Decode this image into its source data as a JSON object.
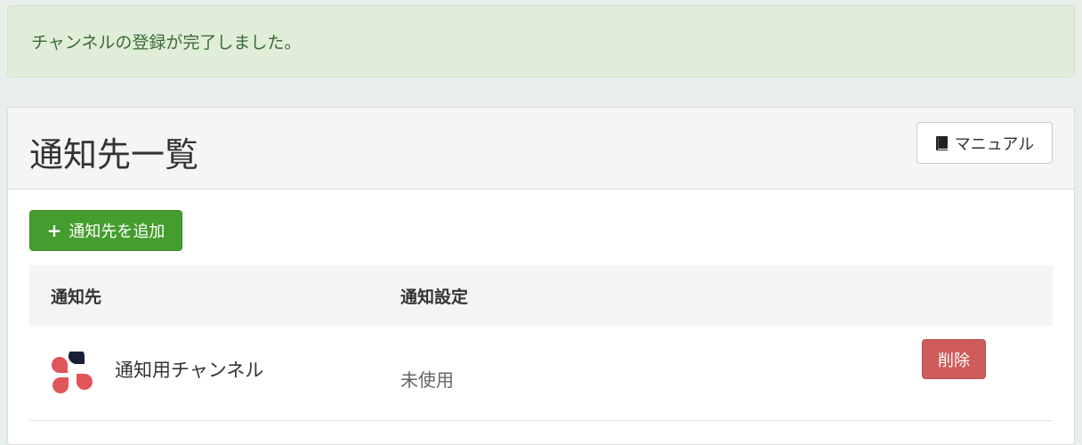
{
  "alert": {
    "message": "チャンネルの登録が完了しました。"
  },
  "panel": {
    "title": "通知先一覧",
    "manual_button": {
      "label": "マニュアル",
      "icon": "book-icon"
    },
    "add_button": {
      "label": "通知先を追加",
      "icon": "plus-icon"
    }
  },
  "table": {
    "headers": {
      "destination": "通知先",
      "setting": "通知設定"
    },
    "rows": [
      {
        "logo": "channel-logo-icon",
        "name": "通知用チャンネル",
        "setting": "未使用",
        "delete_label": "削除"
      }
    ]
  },
  "colors": {
    "alert_bg": "#e0eed9",
    "alert_text": "#3c6b35",
    "add_button": "#449d2e",
    "delete_button": "#cd5c5a"
  }
}
